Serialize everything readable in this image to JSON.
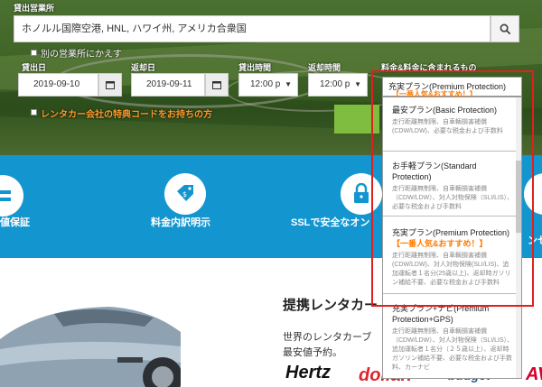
{
  "search": {
    "pickup_label": "貸出営業所",
    "pickup_value": "ホノルル国際空港, HNL, ハワイ州, アメリカ合衆国",
    "different_return": "別の営業所にかえす",
    "pickup_date_label": "貸出日",
    "return_date_label": "返却日",
    "pickup_time_label": "貸出時間",
    "return_time_label": "返却時間",
    "included_label": "料金&料金に含まれるもの",
    "pickup_date": "2019-09-10",
    "return_date": "2019-09-11",
    "pickup_time": "12:00 p",
    "return_time": "12:00 p",
    "coupon_text": "レンタカー会社の特典コードをお持ちの方"
  },
  "dropdown": {
    "selected": "充実プラン(Premium Protection)",
    "selected_sub": "【一番人気&おすすめ！】",
    "options": [
      {
        "name": "最安プラン(Basic Protection)",
        "highlight": "",
        "desc": "走行距離無制限、自車輌損害補償(CDW/LDW)、必要な税金および手数料"
      },
      {
        "name": "お手軽プラン(Standard Protection)",
        "highlight": "",
        "desc": "走行距離無制限、自車輌損害補償（CDW/LDW）、対人対物保険（SLI/LIS）、必要な税金および手数料"
      },
      {
        "name": "充実プラン(Premium Protection)",
        "highlight": "【一番人気&おすすめ！】",
        "desc": "走行距離無制限、自車輌損害補償(CDW/LDW)、対人対物保険(SLI/LIS)、追加運転者１名分(25歳以上)、返却時ガソリン補給不要、必要な税金および手数料"
      },
      {
        "name": "充実プラン+ナビ(Premium Protection+GPS)",
        "highlight": "",
        "desc": "走行距離無制限、自車輌損害補償（CDW/LDW）、対人対物保険（SLI/LIS）、追加運転者１名分（２５歳以上）、返却時ガソリン補給不要、必要な税金および手数料、カーナビ"
      }
    ]
  },
  "features": {
    "item1": "値保証",
    "item2": "料金内訳明示",
    "item3": "SSLで安全なオン",
    "item4": "ンセ"
  },
  "partners": {
    "title": "提携レンタカー",
    "desc": "世界のレンタカーブ 最安値予約。",
    "logos": [
      "Hertz",
      "dollar.",
      "budget",
      "AV"
    ]
  }
}
